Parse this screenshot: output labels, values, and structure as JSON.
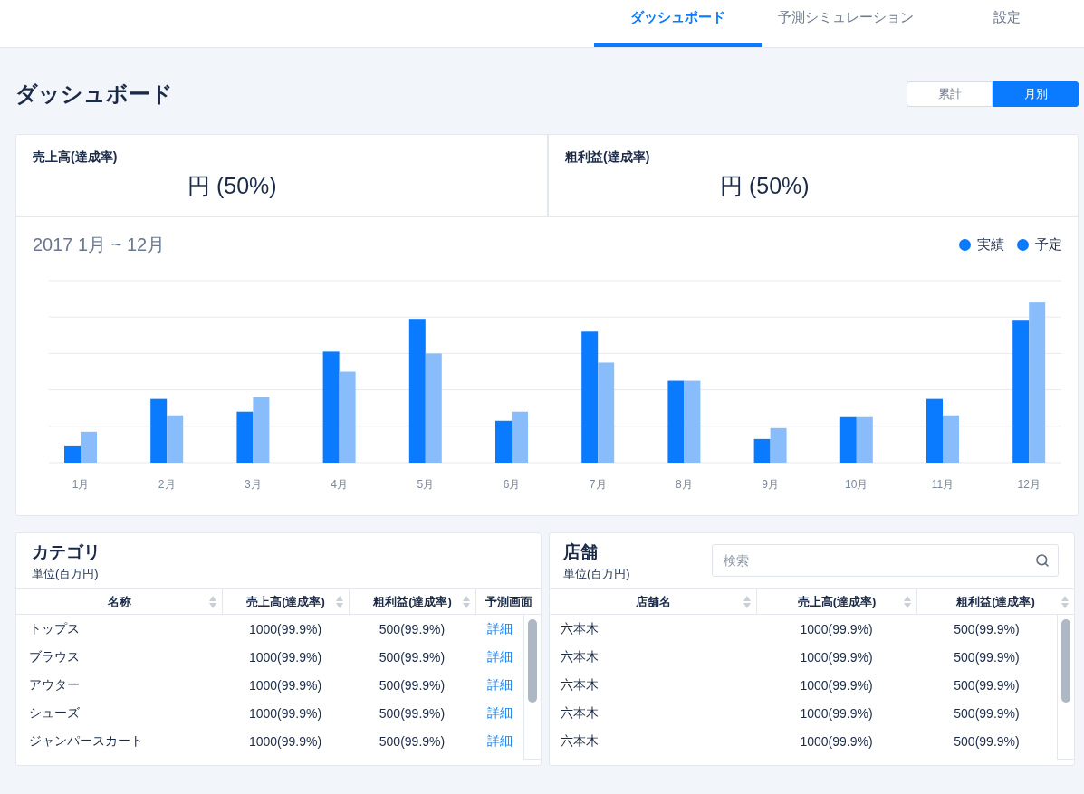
{
  "nav": {
    "tabs": [
      {
        "label": "ダッシュボード",
        "selected": true
      },
      {
        "label": "予測シミュレーション",
        "selected": false
      },
      {
        "label": "設定",
        "selected": false
      }
    ]
  },
  "header": {
    "title": "ダッシュボード",
    "view_toggle": [
      {
        "label": "累計",
        "selected": false
      },
      {
        "label": "月別",
        "selected": true
      }
    ]
  },
  "kpis": [
    {
      "label": "売上高(達成率)",
      "value": "円 (50%)"
    },
    {
      "label": "粗利益(達成率)",
      "value": "円 (50%)"
    }
  ],
  "chart": {
    "period": "2017 1月 ~ 12月",
    "series": [
      {
        "name": "実績",
        "color": "#0a7bff"
      },
      {
        "name": "予定",
        "color": "#89bcfb"
      }
    ],
    "months": [
      "1月",
      "2月",
      "3月",
      "4月",
      "5月",
      "6月",
      "7月",
      "8月",
      "9月",
      "10月",
      "11月",
      "12月"
    ]
  },
  "category_table": {
    "title": "カテゴリ",
    "unit": "単位(百万円)",
    "columns": [
      {
        "label": "名称",
        "sortable": true
      },
      {
        "label": "売上高(達成率)",
        "sortable": true
      },
      {
        "label": "粗利益(達成率)",
        "sortable": true
      },
      {
        "label": "予測画面",
        "sortable": false
      }
    ],
    "rows": [
      {
        "name": "トップス",
        "sales": "1000(99.9%)",
        "gross_profit": "500(99.9%)",
        "detail_link": "詳細"
      },
      {
        "name": "ブラウス",
        "sales": "1000(99.9%)",
        "gross_profit": "500(99.9%)",
        "detail_link": "詳細"
      },
      {
        "name": "アウター",
        "sales": "1000(99.9%)",
        "gross_profit": "500(99.9%)",
        "detail_link": "詳細"
      },
      {
        "name": "シューズ",
        "sales": "1000(99.9%)",
        "gross_profit": "500(99.9%)",
        "detail_link": "詳細"
      },
      {
        "name": "ジャンパースカート",
        "sales": "1000(99.9%)",
        "gross_profit": "500(99.9%)",
        "detail_link": "詳細"
      }
    ]
  },
  "store_table": {
    "title": "店舗",
    "unit": "単位(百万円)",
    "search": {
      "placeholder": "検索"
    },
    "columns": [
      {
        "label": "店舗名",
        "sortable": true
      },
      {
        "label": "売上高(達成率)",
        "sortable": true
      },
      {
        "label": "粗利益(達成率)",
        "sortable": true
      }
    ],
    "rows": [
      {
        "name": "六本木",
        "sales": "1000(99.9%)",
        "gross_profit": "500(99.9%)"
      },
      {
        "name": "六本木",
        "sales": "1000(99.9%)",
        "gross_profit": "500(99.9%)"
      },
      {
        "name": "六本木",
        "sales": "1000(99.9%)",
        "gross_profit": "500(99.9%)"
      },
      {
        "name": "六本木",
        "sales": "1000(99.9%)",
        "gross_profit": "500(99.9%)"
      },
      {
        "name": "六本木",
        "sales": "1000(99.9%)",
        "gross_profit": "500(99.9%)"
      }
    ]
  }
}
